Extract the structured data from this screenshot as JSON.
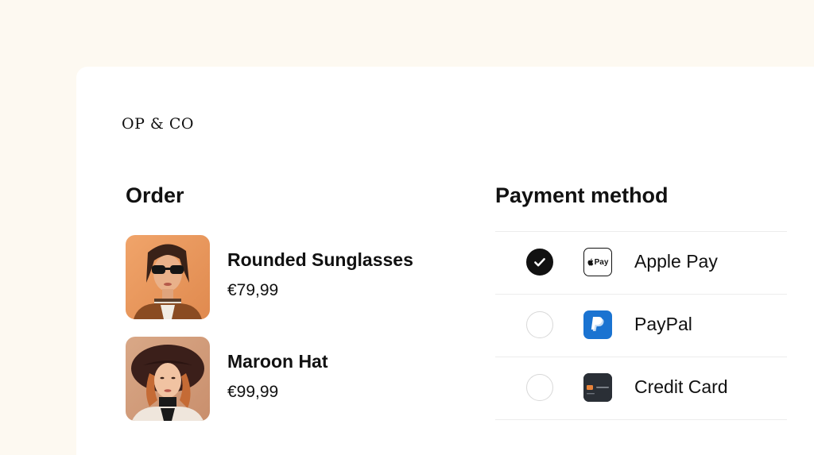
{
  "brand": {
    "logo_text": "OP & CO"
  },
  "order": {
    "title": "Order",
    "items": [
      {
        "name": "Rounded Sunglasses",
        "price": "€79,99",
        "image": "woman-sunglasses-photo"
      },
      {
        "name": "Maroon Hat",
        "price": "€99,99",
        "image": "woman-hat-photo"
      }
    ]
  },
  "payment": {
    "title": "Payment method",
    "methods": [
      {
        "label": "Apple Pay",
        "icon": "apple-pay-icon",
        "icon_text": "Pay",
        "selected": true
      },
      {
        "label": "PayPal",
        "icon": "paypal-icon",
        "selected": false
      },
      {
        "label": "Credit Card",
        "icon": "credit-card-icon",
        "selected": false
      }
    ]
  },
  "colors": {
    "background": "#fdf9f1",
    "card": "#ffffff",
    "text": "#111111",
    "paypal_blue": "#1a73d1",
    "card_dark": "#2a2f36",
    "divider": "#ececec"
  }
}
